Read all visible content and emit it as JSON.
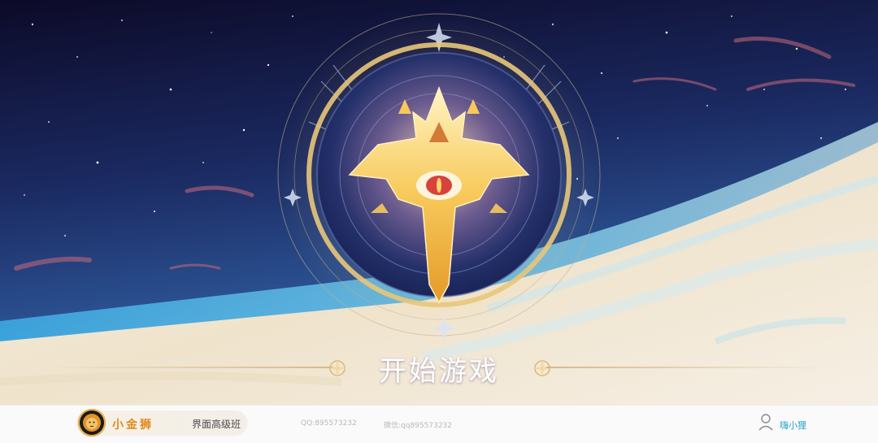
{
  "start_button": {
    "label": "开始游戏"
  },
  "footer": {
    "brand_name": "小金狮",
    "course_name": "界面高级班",
    "qq": "QQ:895573232",
    "wechat": "微信:qq895573232",
    "user_name": "嗨小狸"
  },
  "colors": {
    "sky_top": "#0e0b2c",
    "sky_mid": "#1f3a78",
    "horizon_blue": "#3fb2e8",
    "cloud_cream": "#f4ecd9",
    "gold": "#f5c04d",
    "brand_orange": "#e08a1e",
    "user_blue": "#2b9fc9"
  },
  "icons": [
    "emblem-icon",
    "lion-logo-icon",
    "user-icon",
    "star-ornament-icon"
  ]
}
